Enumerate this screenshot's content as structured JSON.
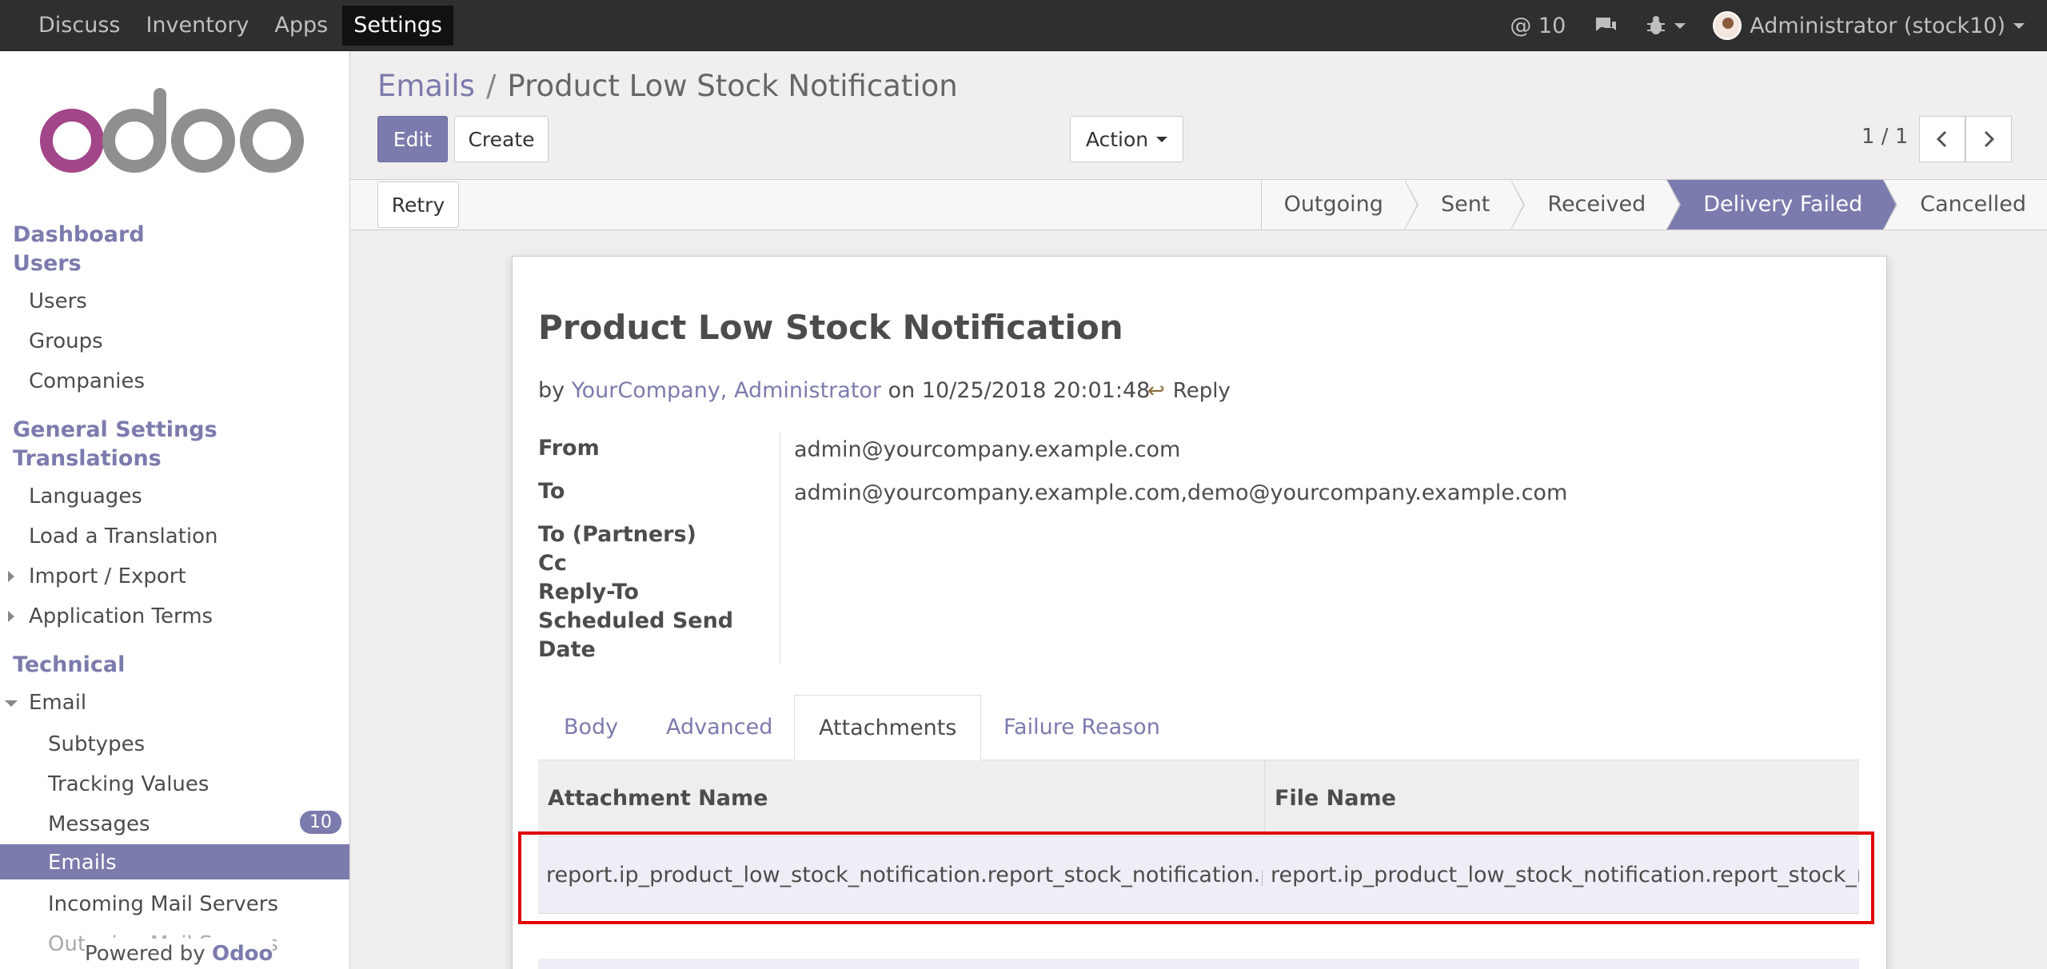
{
  "topbar": {
    "menu": [
      "Discuss",
      "Inventory",
      "Apps",
      "Settings"
    ],
    "active_menu": "Settings",
    "mentions": "@ 10",
    "user": "Administrator (stock10)",
    "icons": [
      "chat-icon",
      "bug-icon",
      "user-avatar"
    ]
  },
  "sidebar": {
    "brand": "odoo",
    "sections": {
      "dashboard": "Dashboard",
      "users": "Users",
      "general": "General Settings",
      "translations": "Translations",
      "technical": "Technical"
    },
    "items": {
      "users": "Users",
      "groups": "Groups",
      "companies": "Companies",
      "languages": "Languages",
      "load_translation": "Load a Translation",
      "import_export": "Import / Export",
      "app_terms": "Application Terms",
      "email": "Email",
      "subtypes": "Subtypes",
      "tracking": "Tracking Values",
      "messages": "Messages",
      "messages_count": "10",
      "emails": "Emails",
      "incoming": "Incoming Mail Servers",
      "outgoing": "Outgoing Mail Servers"
    },
    "powered_prefix": "Powered by",
    "powered_brand": "Odoo"
  },
  "control": {
    "bc_root": "Emails",
    "bc_sep": "/",
    "bc_current": "Product Low Stock Notification",
    "edit": "Edit",
    "create": "Create",
    "action": "Action",
    "pager": "1 / 1"
  },
  "status": {
    "retry": "Retry",
    "stages": [
      "Outgoing",
      "Sent",
      "Received",
      "Delivery Failed",
      "Cancelled"
    ],
    "current_stage": "Delivery Failed"
  },
  "mail": {
    "title": "Product Low Stock Notification",
    "by": "by",
    "author": "YourCompany, Administrator",
    "on": "on 10/25/2018 20:01:48",
    "reply": "Reply",
    "labels": {
      "from": "From",
      "to": "To",
      "to_partners": "To (Partners)",
      "cc": "Cc",
      "reply_to": "Reply-To",
      "scheduled_1": "Scheduled Send",
      "scheduled_2": "Date"
    },
    "values": {
      "from": "admin@yourcompany.example.com",
      "to": "admin@yourcompany.example.com,demo@yourcompany.example.com"
    },
    "tabs": [
      "Body",
      "Advanced",
      "Attachments",
      "Failure Reason"
    ],
    "active_tab": "Attachments",
    "table": {
      "headers": [
        "Attachment Name",
        "File Name"
      ],
      "rows": [
        [
          "report.ip_product_low_stock_notification.report_stock_notification.pdf",
          "report.ip_product_low_stock_notification.report_stock_notification.pdf"
        ]
      ]
    }
  },
  "colors": {
    "accent": "#7c7bad",
    "highlight": "#e00000",
    "topbar": "#2f2f2f"
  }
}
